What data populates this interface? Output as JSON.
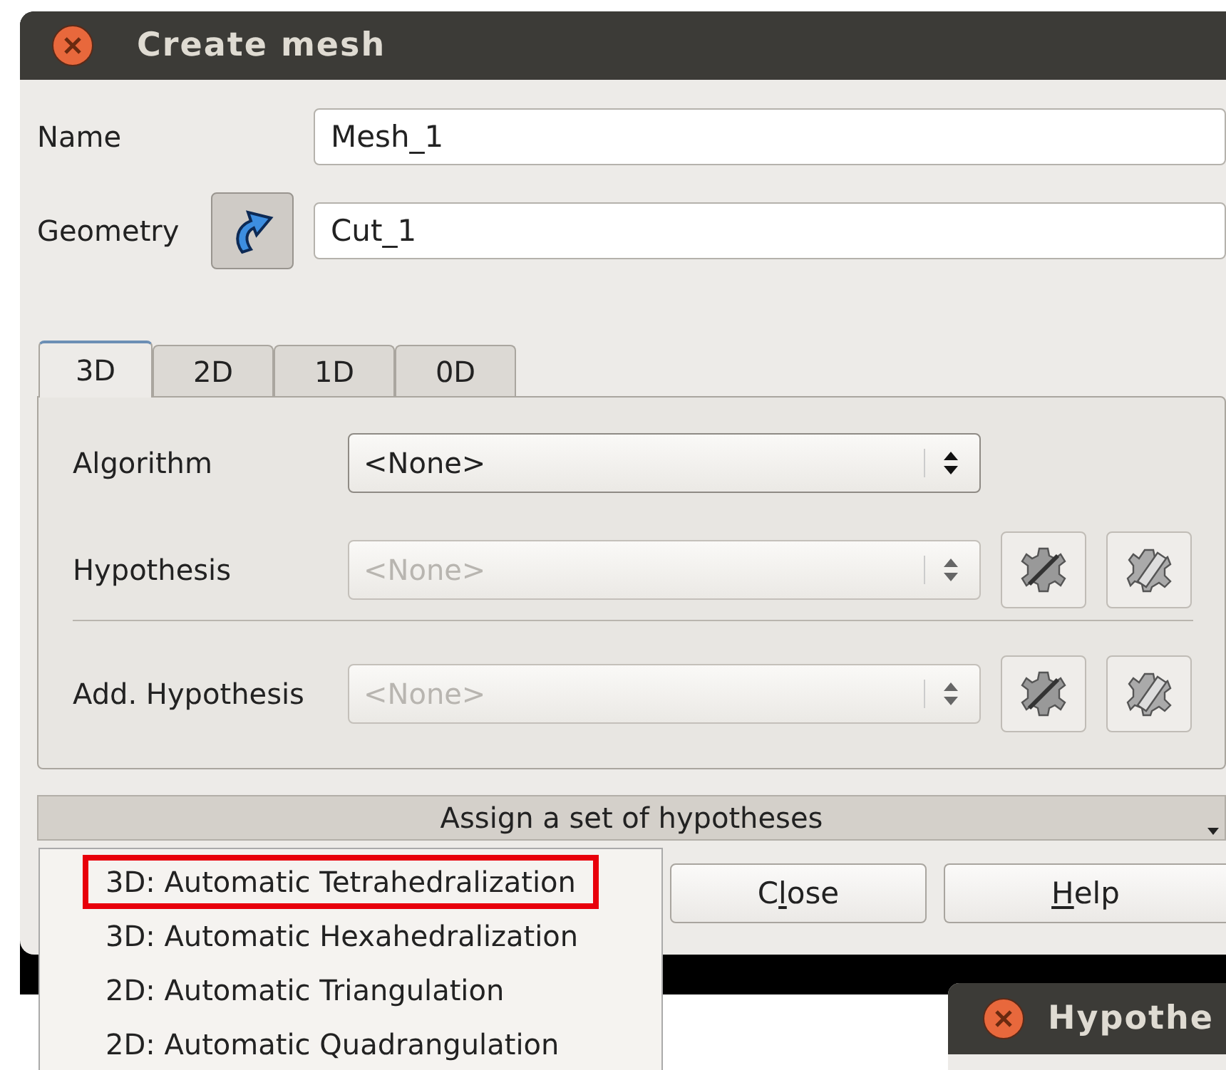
{
  "window": {
    "title": "Create mesh"
  },
  "name": {
    "label": "Name",
    "value": "Mesh_1"
  },
  "geometry": {
    "label": "Geometry",
    "value": "Cut_1"
  },
  "tabs": [
    {
      "label": "3D",
      "selected": true
    },
    {
      "label": "2D",
      "selected": false
    },
    {
      "label": "1D",
      "selected": false
    },
    {
      "label": "0D",
      "selected": false
    }
  ],
  "rows": [
    {
      "label": "Algorithm",
      "value": "<None>",
      "disabled": false,
      "kind": "plain"
    },
    {
      "label": "Hypothesis",
      "value": "<None>",
      "disabled": true,
      "kind": "edit"
    },
    {
      "label": "Add. Hypothesis",
      "value": "<None>",
      "disabled": true,
      "kind": "edit"
    }
  ],
  "assign_bar": {
    "label": "Assign a set of hypotheses"
  },
  "buttons": [
    {
      "before": "C",
      "mnemonic": "l",
      "after": "ose"
    },
    {
      "mnemonic": "H",
      "after": "elp"
    }
  ],
  "menu": [
    {
      "label": "3D: Automatic Tetrahedralization",
      "selected": true
    },
    {
      "label": "3D: Automatic Hexahedralization",
      "selected": false
    },
    {
      "label": "2D: Automatic Triangulation",
      "selected": false
    },
    {
      "label": "2D: Automatic Quadrangulation",
      "selected": false
    }
  ],
  "second_window": {
    "title": "Hypothe"
  }
}
